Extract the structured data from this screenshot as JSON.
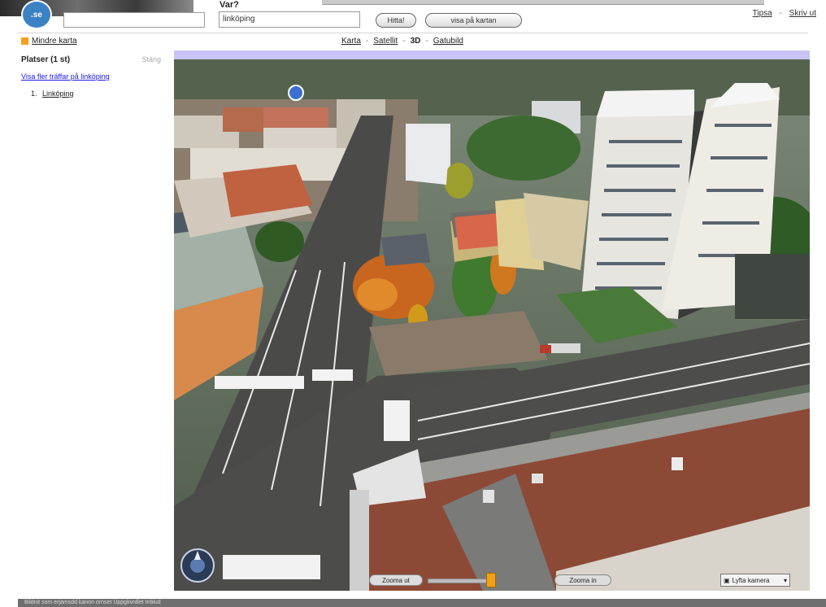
{
  "header": {
    "logo_text": ".se",
    "what_value": "",
    "where_label": "Var?",
    "where_value": "linköping",
    "search_button": "Hitta!",
    "show_on_map_button": "visa på kartan",
    "links": [
      "Tipsa",
      "Skriv ut"
    ]
  },
  "viewbar": {
    "smaller_map": "Mindre karta",
    "tabs": [
      "Karta",
      "Satellit",
      "3D",
      "Gatubild"
    ],
    "active_tab": "3D"
  },
  "sidebar": {
    "title": "Platser (1 st)",
    "close_label": "Stäng",
    "more_hits": "Visa fler träffar på linköping",
    "results": [
      {
        "index": "1.",
        "name": "Linköping"
      }
    ]
  },
  "map": {
    "zoom_out": "Zooma ut",
    "zoom_in": "Zooma in",
    "view_select": "Lyfta kamera",
    "compass_icon": "compass-icon",
    "location_marker_icon": "location-pin-icon",
    "zoom_level": 0.95
  },
  "footer": {
    "text": "Bildnit som erjamsdd kanon ornset Uppgkvrdlet tnblud"
  }
}
